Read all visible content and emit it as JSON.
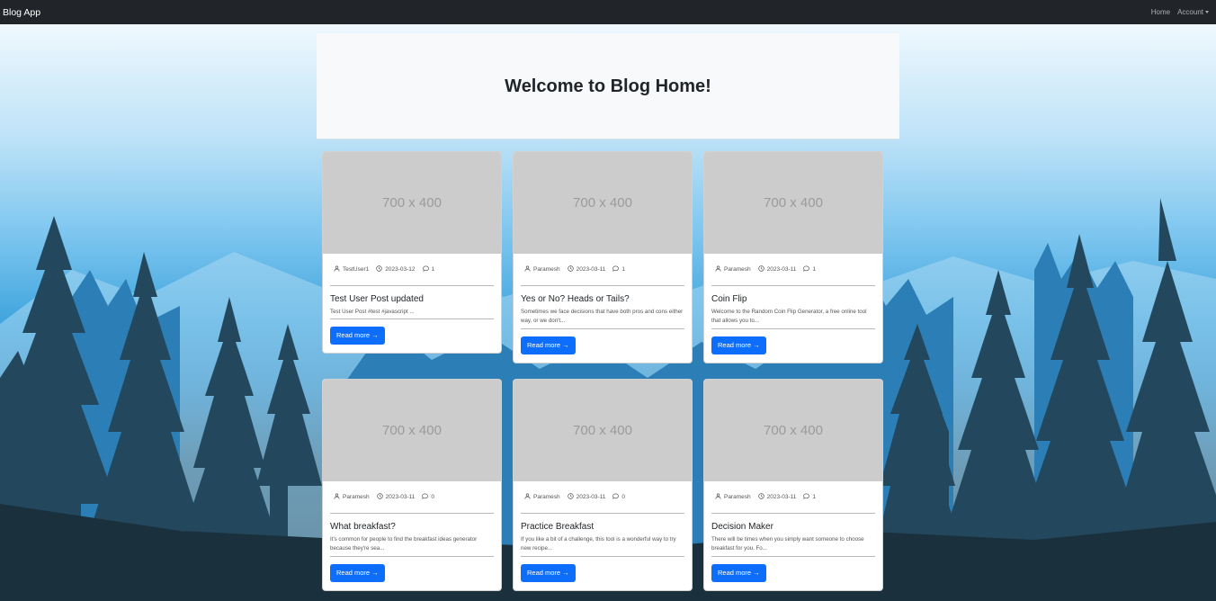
{
  "navbar": {
    "brand": "Blog App",
    "home": "Home",
    "account": "Account"
  },
  "hero": {
    "title": "Welcome to Blog Home!"
  },
  "posts": [
    {
      "image_text": "700 x 400",
      "author": "TestUser1",
      "date": "2023-03-12",
      "comments": "1",
      "title": "Test User Post updated",
      "excerpt": "Test User Post #test #javascript ...",
      "button": "Read more →"
    },
    {
      "image_text": "700 x 400",
      "author": "Paramesh",
      "date": "2023-03-11",
      "comments": "1",
      "title": "Yes or No? Heads or Tails?",
      "excerpt": "Sometimes we face decisions that have both pros and cons either way, or we don't...",
      "button": "Read more →"
    },
    {
      "image_text": "700 x 400",
      "author": "Paramesh",
      "date": "2023-03-11",
      "comments": "1",
      "title": "Coin Flip",
      "excerpt": "Welcome to the Random Coin Flip Generator, a free online tool that allows you to...",
      "button": "Read more →"
    },
    {
      "image_text": "700 x 400",
      "author": "Paramesh",
      "date": "2023-03-11",
      "comments": "0",
      "title": "What breakfast?",
      "excerpt": "It's common for people to find the breakfast ideas generator because they're sea...",
      "button": "Read more →"
    },
    {
      "image_text": "700 x 400",
      "author": "Paramesh",
      "date": "2023-03-11",
      "comments": "0",
      "title": "Practice Breakfast",
      "excerpt": "If you like a bit of a challenge, this tool is a wonderful way to try new recipe...",
      "button": "Read more →"
    },
    {
      "image_text": "700 x 400",
      "author": "Paramesh",
      "date": "2023-03-11",
      "comments": "1",
      "title": "Decision Maker",
      "excerpt": "There will be times when you simply want someone to choose breakfast for you. Fo...",
      "button": "Read more →"
    }
  ]
}
